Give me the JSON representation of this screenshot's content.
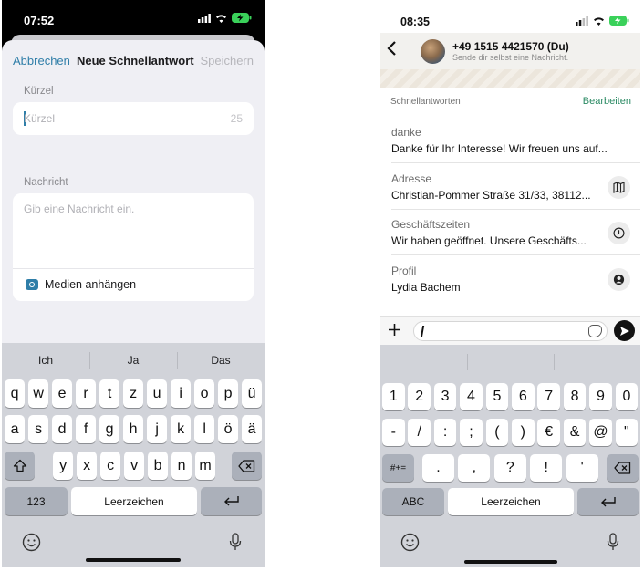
{
  "left_phone": {
    "status_time": "07:52",
    "nav": {
      "cancel": "Abbrechen",
      "title": "Neue Schnellantwort",
      "save": "Speichern"
    },
    "shortcut_label": "Kürzel",
    "shortcut_placeholder": "Kürzel",
    "shortcut_counter": "25",
    "message_label": "Nachricht",
    "message_placeholder": "Gib eine Nachricht ein.",
    "attach_media": "Medien anhängen",
    "keyboard": {
      "suggestions": [
        "Ich",
        "Ja",
        "Das"
      ],
      "row1": [
        "q",
        "w",
        "e",
        "r",
        "t",
        "z",
        "u",
        "i",
        "o",
        "p",
        "ü"
      ],
      "row2": [
        "a",
        "s",
        "d",
        "f",
        "g",
        "h",
        "j",
        "k",
        "l",
        "ö",
        "ä"
      ],
      "row3": [
        "y",
        "x",
        "c",
        "v",
        "b",
        "n",
        "m"
      ],
      "mode_key": "123",
      "space": "Leerzeichen"
    }
  },
  "right_phone": {
    "status_time": "08:35",
    "chat": {
      "name": "+49 1515 4421570 (Du)",
      "subtitle": "Sende dir selbst eine Nachricht."
    },
    "quick_replies": {
      "heading": "Schnellantworten",
      "edit": "Bearbeiten",
      "items": [
        {
          "title": "danke",
          "text": "Danke für Ihr Interesse! Wir freuen uns auf...",
          "icon": ""
        },
        {
          "title": "Adresse",
          "text": "Christian-Pommer Straße 31/33, 38112...",
          "icon": "map-icon"
        },
        {
          "title": "Geschäftszeiten",
          "text": "Wir haben geöffnet. Unsere Geschäfts...",
          "icon": "clock-icon"
        },
        {
          "title": "Profil",
          "text": "Lydia Bachem",
          "icon": "contact-icon"
        }
      ]
    },
    "keyboard": {
      "row1": [
        "1",
        "2",
        "3",
        "4",
        "5",
        "6",
        "7",
        "8",
        "9",
        "0"
      ],
      "row2": [
        "-",
        "/",
        ":",
        ";",
        "(",
        ")",
        "€",
        "&",
        "@",
        "\""
      ],
      "row3": [
        ".",
        ",",
        "?",
        "!",
        "'"
      ],
      "symbols_key": "#+=",
      "mode_key": "ABC",
      "space": "Leerzeichen"
    }
  }
}
